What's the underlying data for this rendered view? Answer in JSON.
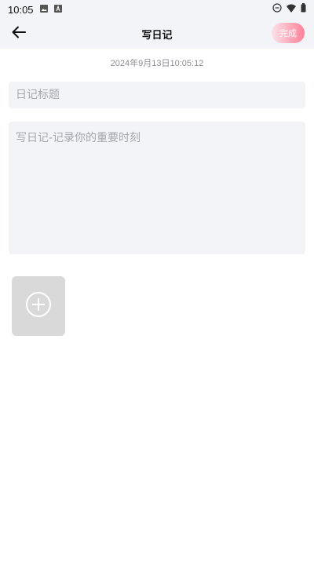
{
  "status_bar": {
    "time": "10:05",
    "icons": [
      "image-icon",
      "text-a-icon",
      "dnd-icon",
      "wifi-icon",
      "battery-icon"
    ]
  },
  "nav": {
    "title": "写日记",
    "done_label": "完成",
    "back_icon": "arrow-left-icon"
  },
  "timestamp": "2024年9月13日10:05:12",
  "form": {
    "title_placeholder": "日记标题",
    "title_value": "",
    "content_placeholder": "写日记-记录你的重要时刻",
    "content_value": ""
  },
  "add_image": {
    "icon": "plus-circle-icon"
  },
  "colors": {
    "background": "#ffffff",
    "header_bg": "#f3f4f8",
    "input_bg": "#f3f4f8",
    "placeholder": "#a6a6ab",
    "timestamp": "#8e8e93",
    "done_gradient_start": "#fbe3ea",
    "done_gradient_end": "#ff7f98",
    "add_image_bg": "#d9d9d9"
  }
}
